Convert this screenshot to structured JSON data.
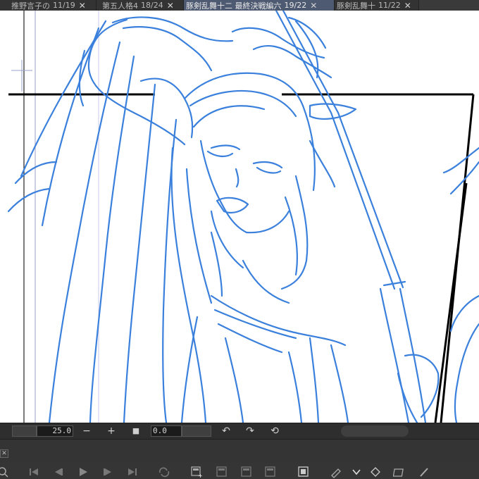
{
  "tabs": [
    {
      "label": "推野言子の",
      "page": "11/19"
    },
    {
      "label": "第五人格4",
      "page": "18/24"
    },
    {
      "label": "豚剣乱舞十二 最終決戦編六",
      "page": "19/22"
    },
    {
      "label": "豚剣乱舞十",
      "page": "11/22"
    }
  ],
  "active_tab": 2,
  "close_glyph": "✕",
  "status": {
    "zoom_value": "25.0",
    "minus_label": "−",
    "plus_label": "+",
    "stop_label": "■",
    "angle_value": "0.0"
  },
  "panel": {
    "close_label": "✕"
  },
  "toolbar_icons": [
    "zoom-icon",
    "first-frame-icon",
    "prev-frame-icon",
    "play-icon",
    "next-frame-icon",
    "last-frame-icon",
    "loop-icon",
    "new-cel-icon",
    "cel-icon",
    "cel-icon-2",
    "cel-icon-3",
    "cel-icon-4",
    "onion-skin-icon",
    "specify-cel-icon",
    "chevron-down-icon",
    "cel-settings-icon",
    "light-table-icon",
    "brush-icon"
  ],
  "colors": {
    "sketch": "#3a80dc",
    "panel_border": "#000000",
    "active_tab": "#4e5a72"
  }
}
